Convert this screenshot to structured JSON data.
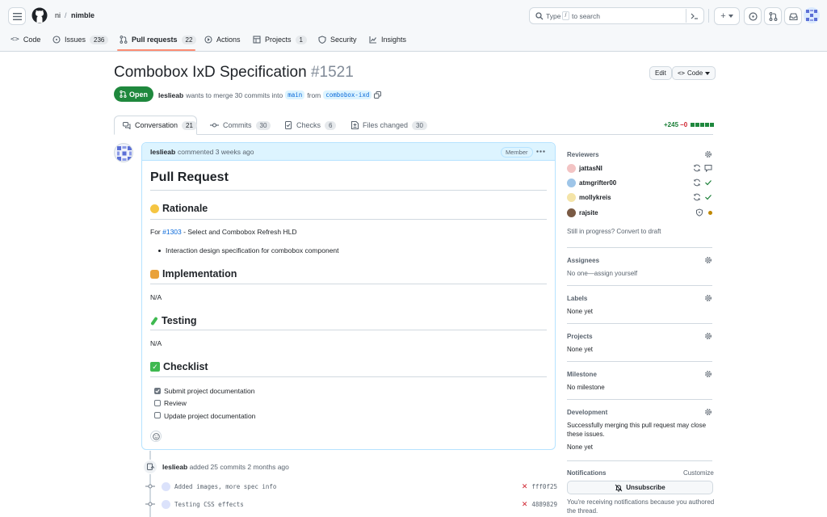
{
  "header": {
    "owner": "ni",
    "separator": "/",
    "repo": "nimble",
    "search_placeholder_pre": "Type",
    "search_key": "/",
    "search_placeholder_post": "to search",
    "plus_label": "+"
  },
  "repo_nav": [
    {
      "label": "Code",
      "count": ""
    },
    {
      "label": "Issues",
      "count": "236"
    },
    {
      "label": "Pull requests",
      "count": "22"
    },
    {
      "label": "Actions",
      "count": ""
    },
    {
      "label": "Projects",
      "count": "1"
    },
    {
      "label": "Security",
      "count": ""
    },
    {
      "label": "Insights",
      "count": ""
    }
  ],
  "pr": {
    "title": "Combobox IxD Specification",
    "number": "#1521",
    "edit_label": "Edit",
    "code_label": "Code",
    "state": "Open",
    "author": "leslieab",
    "merge_text": "wants to merge 30 commits into",
    "base": "main",
    "from_text": "from",
    "head": "combobox-ixd",
    "additions": "+245",
    "deletions": "−0"
  },
  "tabs": [
    {
      "label": "Conversation",
      "count": "21"
    },
    {
      "label": "Commits",
      "count": "30"
    },
    {
      "label": "Checks",
      "count": "6"
    },
    {
      "label": "Files changed",
      "count": "30"
    }
  ],
  "comment": {
    "author": "leslieab",
    "meta": "commented 3 weeks ago",
    "badge": "Member",
    "h1": "Pull Request",
    "rationale_title": "Rationale",
    "rationale_prefix": "For",
    "rationale_link": "#1303",
    "rationale_suffix": "- Select and Combobox Refresh HLD",
    "rationale_bullet": "Interaction design specification for combobox component",
    "impl_title": "Implementation",
    "impl_body": "N/A",
    "testing_title": "Testing",
    "testing_body": "N/A",
    "checklist_title": "Checklist",
    "checklist": [
      {
        "label": "Submit project documentation",
        "checked": true
      },
      {
        "label": "Review",
        "checked": false
      },
      {
        "label": "Update project documentation",
        "checked": false
      }
    ]
  },
  "sidebar": {
    "reviewers_title": "Reviewers",
    "reviewers": [
      {
        "name": "jattasNI",
        "status": "comment"
      },
      {
        "name": "atmgrifter00",
        "status": "approved"
      },
      {
        "name": "mollykreis",
        "status": "approved"
      },
      {
        "name": "rajsite",
        "status": "pending"
      }
    ],
    "draft_prefix": "Still in progress?",
    "draft_link": "Convert to draft",
    "assignees_title": "Assignees",
    "assignees_body_pre": "No one—",
    "assignees_body_link": "assign yourself",
    "labels_title": "Labels",
    "labels_body": "None yet",
    "projects_title": "Projects",
    "projects_body": "None yet",
    "milestone_title": "Milestone",
    "milestone_body": "No milestone",
    "development_title": "Development",
    "development_body": "Successfully merging this pull request may close these issues.",
    "development_none": "None yet",
    "notifications_title": "Notifications",
    "customize": "Customize",
    "unsubscribe": "Unsubscribe",
    "notif_reason": "You're receiving notifications because you authored the thread."
  },
  "timeline": {
    "event_author": "leslieab",
    "event_text": "added 25 commits 2 months ago",
    "commits": [
      {
        "message": "Added images, more spec info",
        "sha": "fff0f25"
      },
      {
        "message": "Testing CSS effects",
        "sha": "4889829"
      }
    ]
  },
  "colors": {
    "accent_link": "#0969da",
    "open_green": "#1f883d",
    "danger": "#cf222e",
    "nav_underline": "#fd8c73"
  }
}
